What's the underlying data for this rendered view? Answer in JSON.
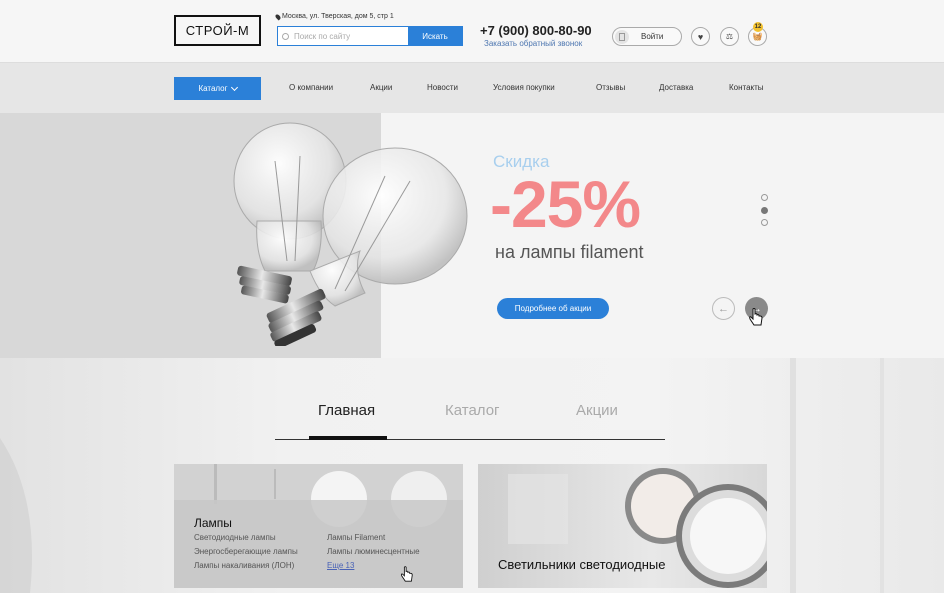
{
  "header": {
    "logo": "СТРОЙ-М",
    "address": "Москва, ул. Тверская, дом 5, стр 1",
    "search_placeholder": "Поиск по сайту",
    "search_button": "Искать",
    "phone": "+7 (900) 800-80-90",
    "callback_link": "Заказать обратный звонок",
    "login_label": "Войти",
    "cart_count": "12"
  },
  "nav": {
    "catalog_label": "Каталог",
    "items": [
      "О компании",
      "Акции",
      "Новости",
      "Условия покупки",
      "Отзывы",
      "Доставка",
      "Контакты"
    ]
  },
  "hero": {
    "promo_small": "Скидка",
    "promo_big": "-25%",
    "promo_sub": "на лампы filament",
    "button": "Подробнее об акции",
    "slides_total": 3,
    "active_slide": 2
  },
  "tabs": {
    "items": [
      "Главная",
      "Каталог",
      "Акции"
    ],
    "active": "Главная"
  },
  "cards": {
    "lamps": {
      "title": "Лампы",
      "col1": [
        "Светодиодные лампы",
        "Энергосберегающие лампы",
        "Лампы накаливания (ЛОН)"
      ],
      "col2": [
        "Лампы Filament",
        "Лампы люминесцентные"
      ],
      "more": "Еще 13"
    },
    "led": {
      "title": "Светильники светодиодные"
    }
  },
  "colors": {
    "accent": "#2b80d8",
    "promo": "#f3888a",
    "promo_light": "#a8cfee"
  }
}
